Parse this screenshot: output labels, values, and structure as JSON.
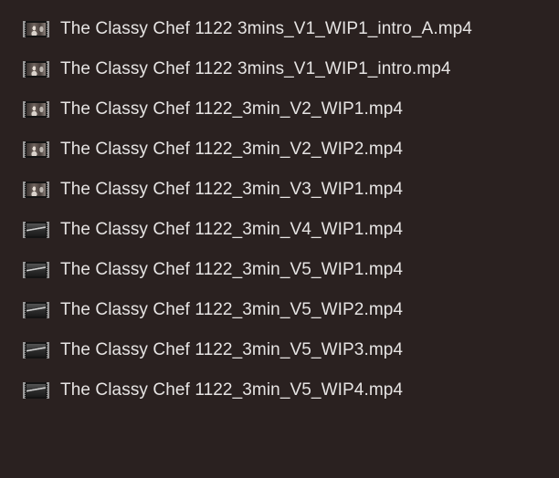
{
  "files": [
    {
      "name": "The Classy Chef 1122 3mins_V1_WIP1_intro_A.mp4",
      "thumbnail": "portrait"
    },
    {
      "name": "The Classy Chef 1122 3mins_V1_WIP1_intro.mp4",
      "thumbnail": "portrait"
    },
    {
      "name": "The Classy Chef 1122_3min_V2_WIP1.mp4",
      "thumbnail": "portrait"
    },
    {
      "name": "The Classy Chef 1122_3min_V2_WIP2.mp4",
      "thumbnail": "portrait"
    },
    {
      "name": "The Classy Chef 1122_3min_V3_WIP1.mp4",
      "thumbnail": "portrait"
    },
    {
      "name": "The Classy Chef 1122_3min_V4_WIP1.mp4",
      "thumbnail": "landscape"
    },
    {
      "name": "The Classy Chef 1122_3min_V5_WIP1.mp4",
      "thumbnail": "landscape"
    },
    {
      "name": "The Classy Chef 1122_3min_V5_WIP2.mp4",
      "thumbnail": "landscape"
    },
    {
      "name": "The Classy Chef 1122_3min_V5_WIP3.mp4",
      "thumbnail": "landscape"
    },
    {
      "name": "The Classy Chef 1122_3min_V5_WIP4.mp4",
      "thumbnail": "landscape"
    }
  ],
  "colors": {
    "background": "#2a2120",
    "text": "#e6e4e3"
  }
}
